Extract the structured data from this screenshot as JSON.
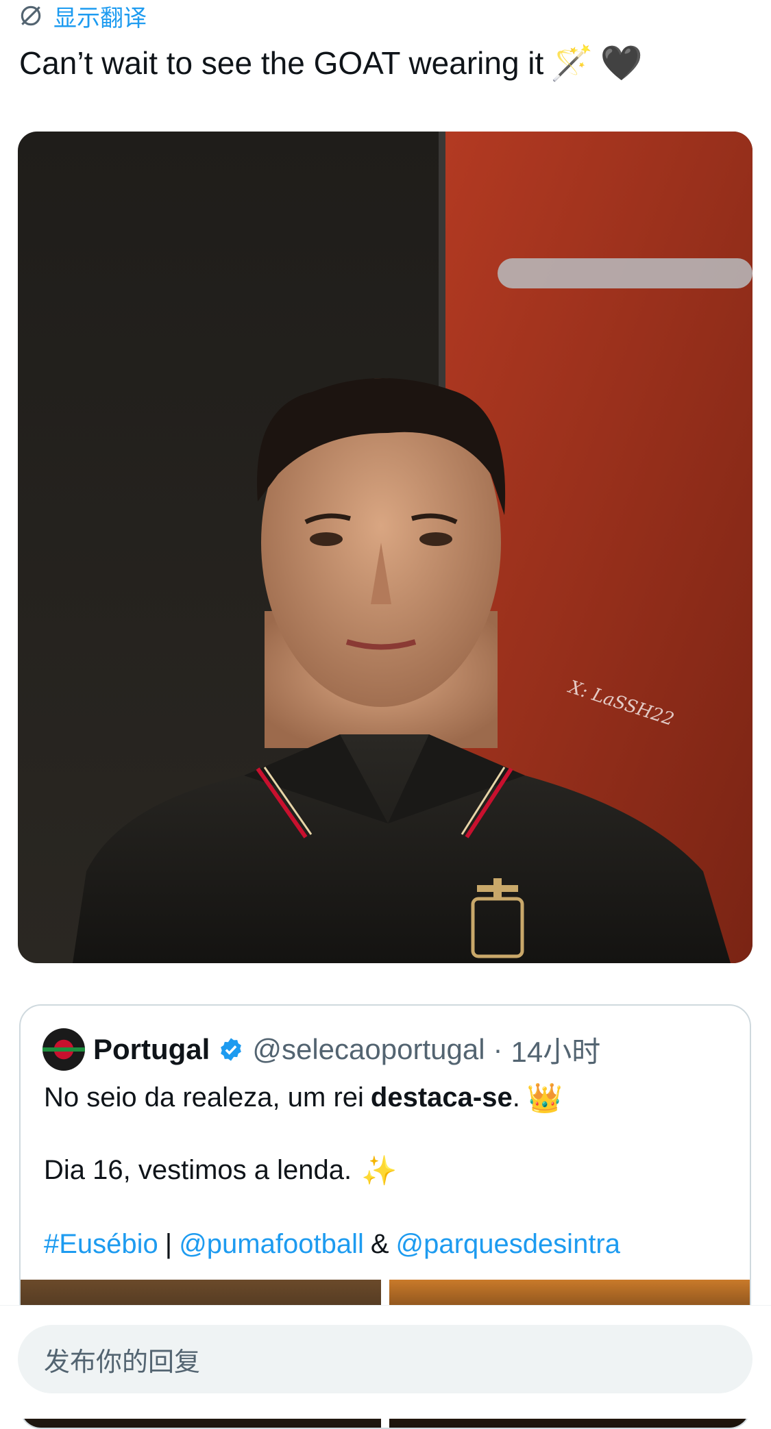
{
  "translate": {
    "label": "显示翻译",
    "icon": "translate-icon"
  },
  "tweet": {
    "text": "Can’t wait to see the GOAT wearing it",
    "emojis": [
      "🪄",
      "🖤"
    ]
  },
  "media": {
    "alt_watermark": "X: LaSSH22"
  },
  "quote": {
    "name": "Portugal",
    "verified": true,
    "handle": "@selecaoportugal",
    "separator": "·",
    "time": "14小时",
    "line1_prefix": "No seio da realeza, um rei",
    "line1_bold": "destaca-se",
    "line1_suffix": ".",
    "line1_emoji": "👑",
    "line2_text": "Dia 16, vestimos a lenda.",
    "line2_emoji": "✨",
    "hashtag": "#Eusébio",
    "pipe": "|",
    "mention1": "@pumafootball",
    "amp": "&",
    "mention2": "@parquesdesintra"
  },
  "reply": {
    "placeholder": "发布你的回复"
  },
  "colors": {
    "link": "#1d9bf0",
    "text": "#0f1419",
    "muted": "#536471"
  }
}
